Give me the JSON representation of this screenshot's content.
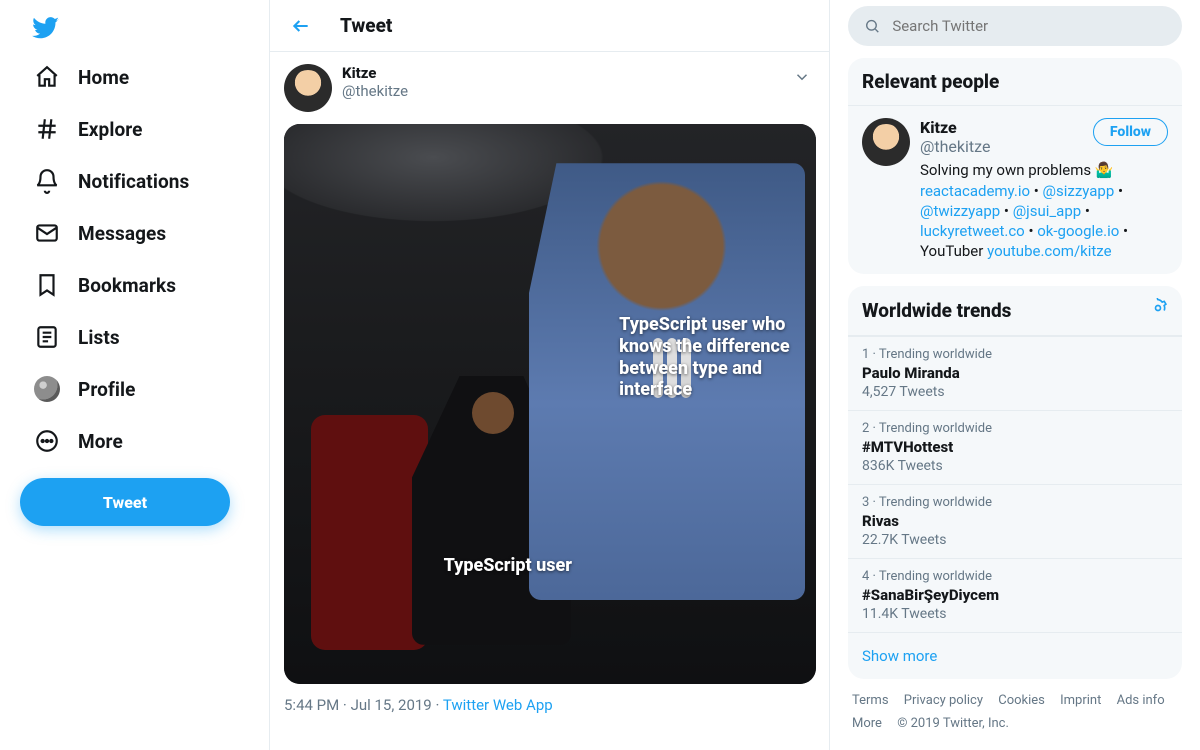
{
  "header": {
    "title": "Tweet"
  },
  "sidebar": {
    "items": [
      {
        "label": "Home"
      },
      {
        "label": "Explore"
      },
      {
        "label": "Notifications"
      },
      {
        "label": "Messages"
      },
      {
        "label": "Bookmarks"
      },
      {
        "label": "Lists"
      },
      {
        "label": "Profile"
      },
      {
        "label": "More"
      }
    ],
    "compose_label": "Tweet"
  },
  "tweet": {
    "author": {
      "name": "Kitze",
      "handle": "@thekitze"
    },
    "image_captions": {
      "expert": "TypeScript user who knows the difference between type and interface",
      "novice": "TypeScript user"
    },
    "timestamp": "5:44 PM · Jul 15, 2019",
    "source": "Twitter Web App"
  },
  "search": {
    "placeholder": "Search Twitter"
  },
  "relevant": {
    "heading": "Relevant people",
    "follow_label": "Follow",
    "person": {
      "name": "Kitze",
      "handle": "@thekitze",
      "bio_lead": "Solving my own problems 🤷‍♂️",
      "links": [
        "reactacademy.io",
        "@sizzyapp",
        "@twizzyapp",
        "@jsui_app",
        "luckyretweet.co",
        "ok-google.io"
      ],
      "bio_mid": "YouTuber",
      "yt": "youtube.com/kitze"
    }
  },
  "trends": {
    "heading": "Worldwide trends",
    "items": [
      {
        "rank": "1",
        "sub": "Trending worldwide",
        "title": "Paulo Miranda",
        "count": "4,527 Tweets"
      },
      {
        "rank": "2",
        "sub": "Trending worldwide",
        "title": "#MTVHottest",
        "count": "836K Tweets"
      },
      {
        "rank": "3",
        "sub": "Trending worldwide",
        "title": "Rivas",
        "count": "22.7K Tweets"
      },
      {
        "rank": "4",
        "sub": "Trending worldwide",
        "title": "#SanaBirŞeyDiycem",
        "count": "11.4K Tweets"
      }
    ],
    "show_more": "Show more"
  },
  "footer": {
    "links": [
      "Terms",
      "Privacy policy",
      "Cookies",
      "Imprint",
      "Ads info",
      "More"
    ],
    "copyright": "© 2019 Twitter, Inc."
  }
}
